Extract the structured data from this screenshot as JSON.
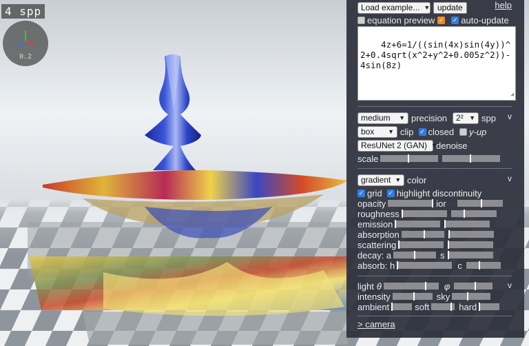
{
  "viewport": {
    "spp_label": "4 spp",
    "zoom_label": "0.2",
    "colors": {
      "sky": "#e9eef2",
      "floor_light": "#f5f6f7",
      "floor_dark": "#8d939a"
    }
  },
  "panel": {
    "load_example": "Load example...",
    "update": "update",
    "help": "help",
    "equation_preview": "equation preview",
    "equation_preview_on": true,
    "auto_update": "auto-update",
    "auto_update_on": true,
    "equation": "4z+6=1/((sin(4x)sin(4y))^2+0.4sqrt(x^2+y^2+0.005z^2))-4sin(8z)",
    "render": {
      "precision_value": "medium",
      "precision_label": "precision",
      "spp_value": "2²",
      "spp_label": "spp",
      "collapse": "v",
      "clip_value": "box",
      "clip_label": "clip",
      "closed_label": "closed",
      "closed_on": true,
      "yup_label": "y-up",
      "yup_on": false,
      "denoise_value": "ResUNet 2 (GAN)",
      "denoise_label": "denoise",
      "scale_label": "scale"
    },
    "material": {
      "color_value": "gradient",
      "color_label": "color",
      "collapse": "v",
      "grid_label": "grid",
      "grid_on": true,
      "highlight_label": "highlight discontinuity",
      "highlight_on": true,
      "opacity": "opacity",
      "ior": "ior",
      "roughness": "roughness",
      "emission": "emission",
      "absorption": "absorption",
      "scattering": "scattering",
      "decay": "decay: a",
      "decay_s": "s",
      "absorb": "absorb: h",
      "absorb_c": "c"
    },
    "lighting": {
      "light": "light",
      "theta": "θ",
      "phi": "φ",
      "collapse": "v",
      "intensity": "intensity",
      "sky": "sky",
      "ambient": "ambient",
      "soft": "soft",
      "hard": "hard"
    },
    "camera": "> camera"
  }
}
